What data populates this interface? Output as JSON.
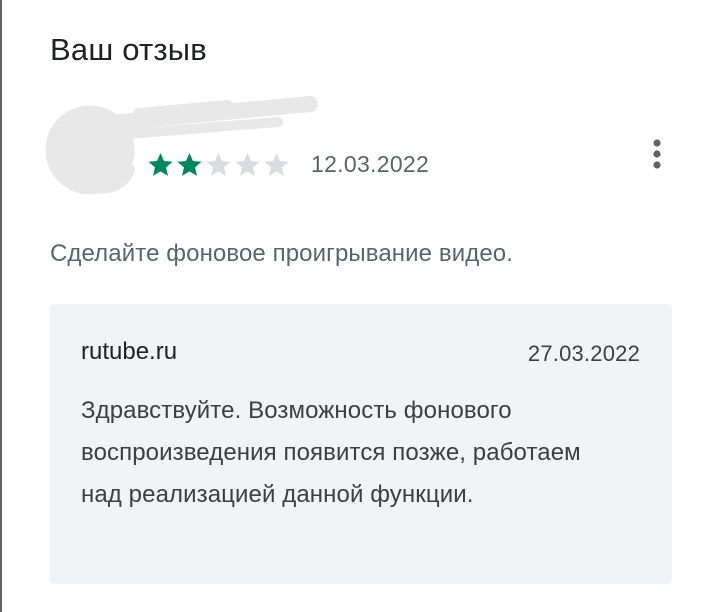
{
  "section": {
    "title": "Ваш отзыв"
  },
  "review": {
    "rating": 2,
    "max_rating": 5,
    "date": "12.03.2022",
    "text": "Сделайте фоновое проигрывание видео.",
    "author_redacted": true,
    "menu_icon": "more-vert-icon",
    "star_color": "#01875f",
    "empty_star_color": "#dadce0"
  },
  "reply": {
    "author": "rutube.ru",
    "date": "27.03.2022",
    "text": "Здравствуйте. Возможность фонового воспроизведения появится позже, работаем над реализацией данной функции."
  },
  "colors": {
    "reply_background": "#f1f3f4",
    "secondary_text": "#5f6368"
  }
}
